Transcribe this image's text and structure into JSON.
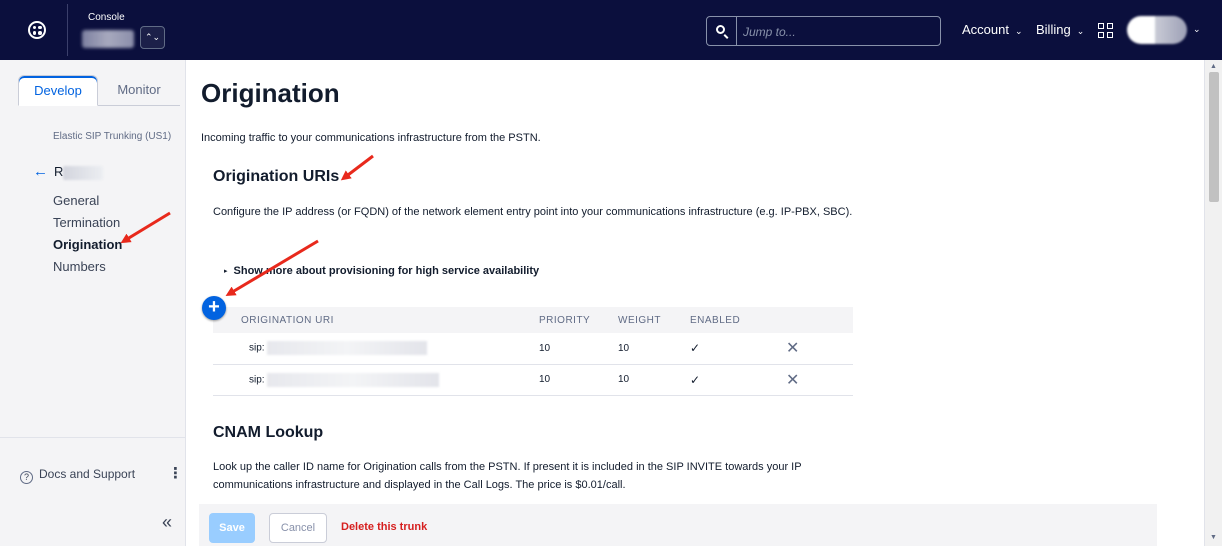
{
  "topbar": {
    "console_label": "Console",
    "account_switch_glyph": "⌃⌄",
    "search_placeholder": "Jump to...",
    "account_label": "Account",
    "billing_label": "Billing",
    "chevron_glyph": "⌄",
    "background_color": "#0b0f3d"
  },
  "sidebar": {
    "tabs": [
      {
        "label": "Develop",
        "active": true
      },
      {
        "label": "Monitor",
        "active": false
      }
    ],
    "product_label": "Elastic SIP Trunking (US1)",
    "back_arrow_glyph": "←",
    "trunk_name_visible": "R",
    "nav_items": [
      {
        "label": "General",
        "active": false
      },
      {
        "label": "Termination",
        "active": false
      },
      {
        "label": "Origination",
        "active": true
      },
      {
        "label": "Numbers",
        "active": false
      }
    ],
    "help_glyph": "?",
    "docs_label": "Docs and Support",
    "kebab_glyph": "⋮",
    "collapse_glyph": "«"
  },
  "main": {
    "title": "Origination",
    "description": "Incoming traffic to your communications infrastructure from the PSTN.",
    "uris_section": {
      "title": "Origination URIs",
      "description": "Configure the IP address (or FQDN) of the network element entry point into your communications infrastructure (e.g. IP-PBX, SBC).",
      "disclosure_glyph": "▸",
      "disclosure_label": "Show more about provisioning for high service availability",
      "add_glyph": "+",
      "columns": [
        "ORIGINATION URI",
        "PRIORITY",
        "WEIGHT",
        "ENABLED"
      ],
      "rows": [
        {
          "uri_prefix": "sip:",
          "priority": "10",
          "weight": "10",
          "enabled": "✓",
          "remove": "✕"
        },
        {
          "uri_prefix": "sip:",
          "priority": "10",
          "weight": "10",
          "enabled": "✓",
          "remove": "✕"
        }
      ]
    },
    "cnam_section": {
      "title": "CNAM Lookup",
      "description": "Look up the caller ID name for Origination calls from the PSTN. If present it is included in the SIP INVITE towards your IP communications infrastructure and displayed in the Call Logs. The price is $0.01/call."
    },
    "footer": {
      "save_label": "Save",
      "cancel_label": "Cancel",
      "delete_label": "Delete this trunk"
    }
  },
  "scrollbar": {
    "up_glyph": "▲",
    "down_glyph": "▼"
  },
  "colors": {
    "accent": "#0263e0",
    "danger": "#d61f1f",
    "annotation": "#e8291c"
  }
}
